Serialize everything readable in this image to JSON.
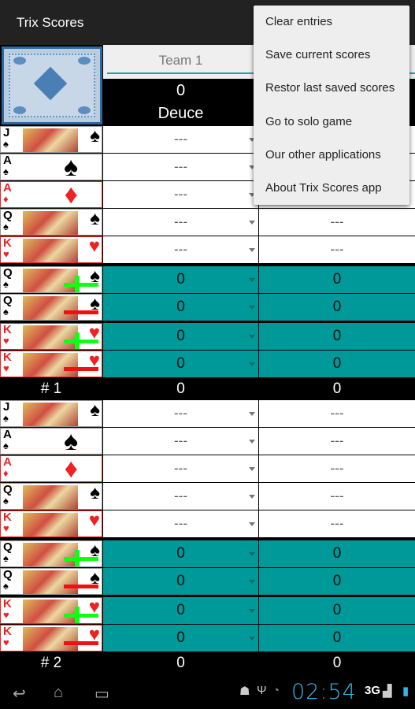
{
  "app": {
    "title": "Trix Scores"
  },
  "team": {
    "name": "Team 1",
    "score": "0",
    "mode": "Deuce"
  },
  "colors": {
    "accent": "#009999",
    "clock": "#33b5e5"
  },
  "rounds": [
    {
      "label": "# 1",
      "total_mid": "0",
      "total_right": "0"
    },
    {
      "label": "# 2",
      "total_mid": "0",
      "total_right": "0"
    }
  ],
  "rows": [
    {
      "card": "jack-of-spades",
      "rank": "J",
      "suit": "♠",
      "red": false,
      "face": true,
      "mark": "",
      "type": "white",
      "mid": "---",
      "right": "---"
    },
    {
      "card": "ace-of-spades",
      "rank": "A",
      "suit": "♠",
      "red": false,
      "face": false,
      "mark": "",
      "type": "white",
      "mid": "---",
      "right": "---"
    },
    {
      "card": "ace-of-diamonds",
      "rank": "A",
      "suit": "♦",
      "red": true,
      "face": false,
      "mark": "",
      "type": "white",
      "mid": "---",
      "right": "---"
    },
    {
      "card": "queen-of-spades",
      "rank": "Q",
      "suit": "♠",
      "red": false,
      "face": true,
      "mark": "",
      "type": "white",
      "mid": "---",
      "right": "---"
    },
    {
      "card": "king-of-hearts",
      "rank": "K",
      "suit": "♥",
      "red": true,
      "face": true,
      "mark": "",
      "type": "white",
      "mid": "---",
      "right": "---"
    },
    {
      "card": "queen-of-spades-plus",
      "rank": "Q",
      "suit": "♠",
      "red": false,
      "face": true,
      "mark": "plus",
      "type": "teal",
      "mid": "0",
      "right": "0"
    },
    {
      "card": "queen-of-spades-minus",
      "rank": "Q",
      "suit": "♠",
      "red": false,
      "face": true,
      "mark": "minus",
      "type": "teal",
      "mid": "0",
      "right": "0"
    },
    {
      "card": "king-of-hearts-plus",
      "rank": "K",
      "suit": "♥",
      "red": true,
      "face": true,
      "mark": "plus",
      "type": "teal",
      "mid": "0",
      "right": "0"
    },
    {
      "card": "king-of-hearts-minus",
      "rank": "K",
      "suit": "♥",
      "red": true,
      "face": true,
      "mark": "minus",
      "type": "teal",
      "mid": "0",
      "right": "0"
    }
  ],
  "menu": [
    "Clear entries",
    "Save current scores",
    "Restor last saved scores",
    "Go to solo game",
    "Our other applications",
    "About Trix Scores app"
  ],
  "status": {
    "time": "02:54",
    "network": "3G"
  }
}
